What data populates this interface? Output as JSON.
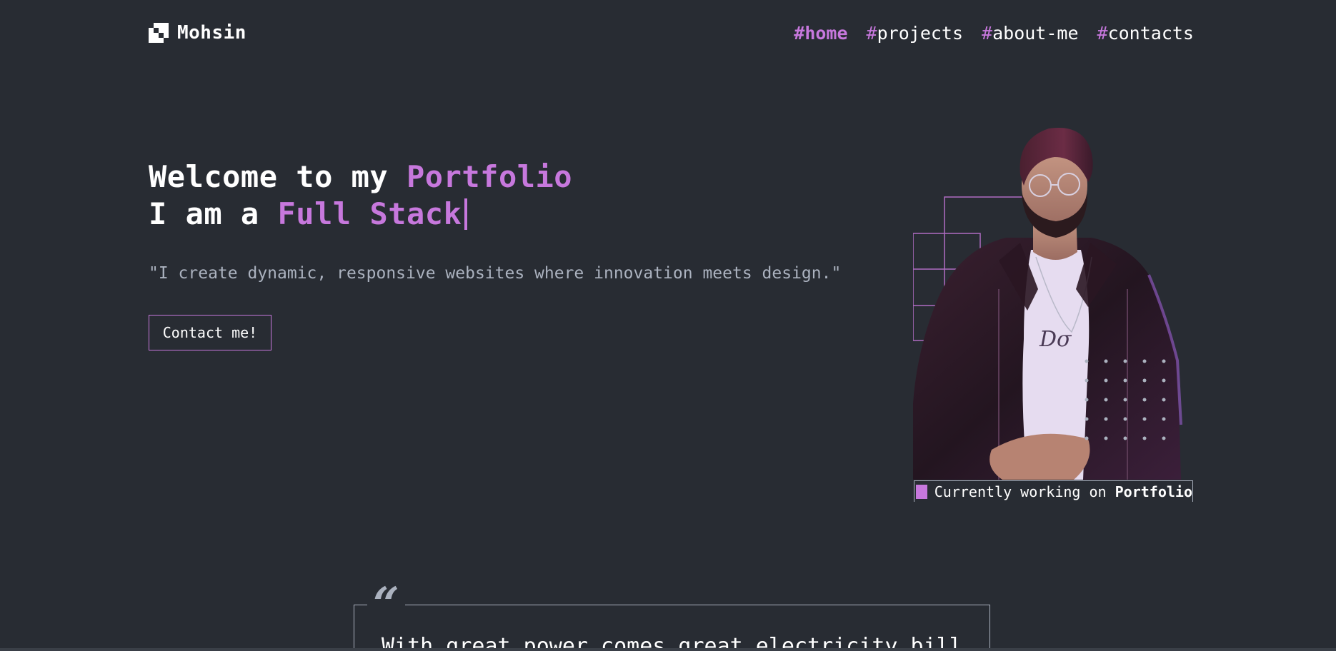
{
  "nav": {
    "brand": "Mohsin",
    "links": [
      {
        "hash": "#",
        "label": "home",
        "active": true
      },
      {
        "hash": "#",
        "label": "projects",
        "active": false
      },
      {
        "hash": "#",
        "label": "about-me",
        "active": false
      },
      {
        "hash": "#",
        "label": "contacts",
        "active": false
      }
    ]
  },
  "hero": {
    "line1_prefix": "Welcome to my ",
    "line1_accent": "Portfolio",
    "line2_prefix": "I am a ",
    "line2_accent": "Full Stack",
    "tagline": "\"I create dynamic, responsive websites where innovation meets design.\"",
    "cta_label": "Contact me!"
  },
  "status": {
    "prefix": "Currently working on ",
    "project": "Portfolio"
  },
  "quote": {
    "mark": "“",
    "text": "With great power comes great electricity bill"
  },
  "colors": {
    "background": "#282c33",
    "accent": "#c778dd",
    "muted": "#abb2bf",
    "text": "#ffffff"
  },
  "icons": {
    "logo": "brand-logo-icon",
    "status": "status-square-icon",
    "quote": "quote-mark-icon"
  }
}
